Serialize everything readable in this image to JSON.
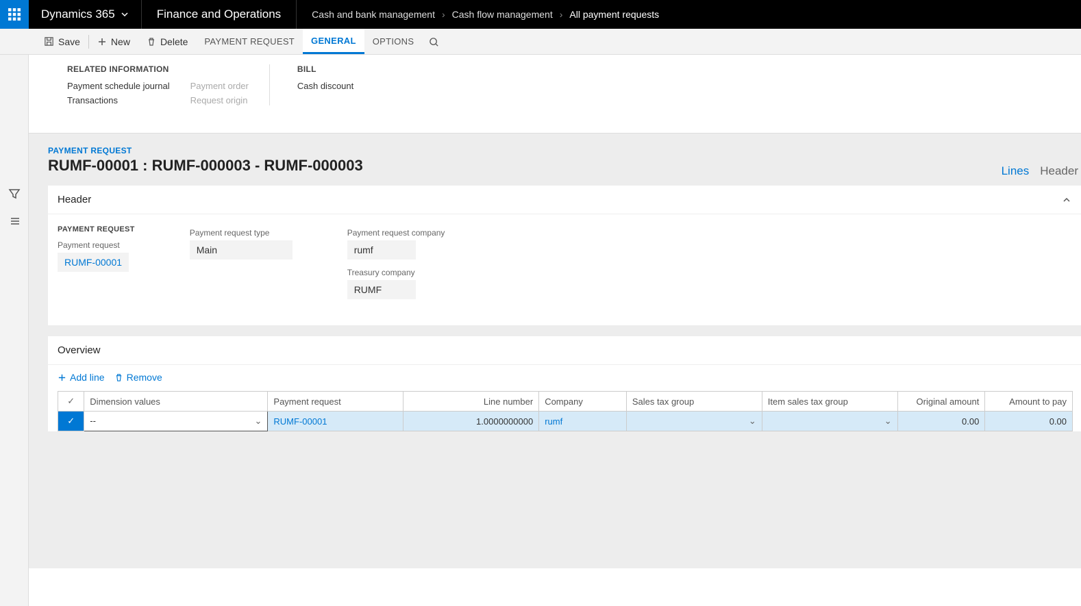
{
  "topbar": {
    "brand": "Dynamics 365",
    "module": "Finance and Operations",
    "breadcrumb": [
      "Cash and bank management",
      "Cash flow management",
      "All payment requests"
    ]
  },
  "actions": {
    "save": "Save",
    "new": "New",
    "delete": "Delete",
    "tabs": [
      "PAYMENT REQUEST",
      "GENERAL",
      "OPTIONS"
    ],
    "active_tab": "GENERAL"
  },
  "subpanel": {
    "related_title": "RELATED INFORMATION",
    "related_col1": [
      "Payment schedule journal",
      "Transactions"
    ],
    "related_col2": [
      "Payment order",
      "Request origin"
    ],
    "bill_title": "BILL",
    "bill_items": [
      "Cash discount"
    ]
  },
  "page": {
    "pretitle": "PAYMENT REQUEST",
    "title": "RUMF-00001 : RUMF-000003 - RUMF-000003",
    "view_lines": "Lines",
    "view_header": "Header"
  },
  "header_card": {
    "title": "Header",
    "group_title": "PAYMENT REQUEST",
    "payment_request_label": "Payment request",
    "payment_request_value": "RUMF-00001",
    "type_label": "Payment request type",
    "type_value": "Main",
    "company_label": "Payment request company",
    "company_value": "rumf",
    "treasury_label": "Treasury company",
    "treasury_value": "RUMF"
  },
  "overview": {
    "title": "Overview",
    "add_line": "Add line",
    "remove": "Remove",
    "columns": [
      "Dimension values",
      "Payment request",
      "Line number",
      "Company",
      "Sales tax group",
      "Item sales tax group",
      "Original amount",
      "Amount to pay"
    ],
    "row": {
      "dimension": "--",
      "payment_request": "RUMF-00001",
      "line_number": "1.0000000000",
      "company": "rumf",
      "sales_tax_group": "",
      "item_sales_tax_group": "",
      "original_amount": "0.00",
      "amount_to_pay": "0.00"
    }
  }
}
